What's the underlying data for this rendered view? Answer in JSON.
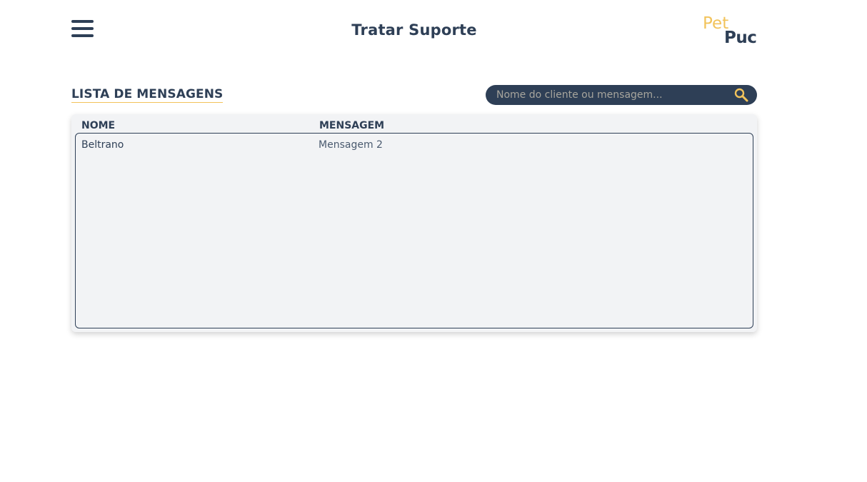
{
  "header": {
    "title": "Tratar Suporte",
    "menu_icon": "hamburger-menu-icon",
    "logo": {
      "part1": "Pet",
      "part2": "Puc"
    }
  },
  "section": {
    "title": "LISTA DE MENSAGENS"
  },
  "search": {
    "placeholder": "Nome do cliente ou mensagem...",
    "value": "",
    "icon": "search-icon"
  },
  "table": {
    "columns": [
      "NOME",
      "MENSAGEM"
    ],
    "rows": [
      {
        "nome": "Beltrano",
        "mensagem": "Mensagem 2"
      }
    ]
  },
  "colors": {
    "primary": "#2e3f56",
    "accent": "#f2c35b",
    "card_background": "#f2f3f5"
  }
}
